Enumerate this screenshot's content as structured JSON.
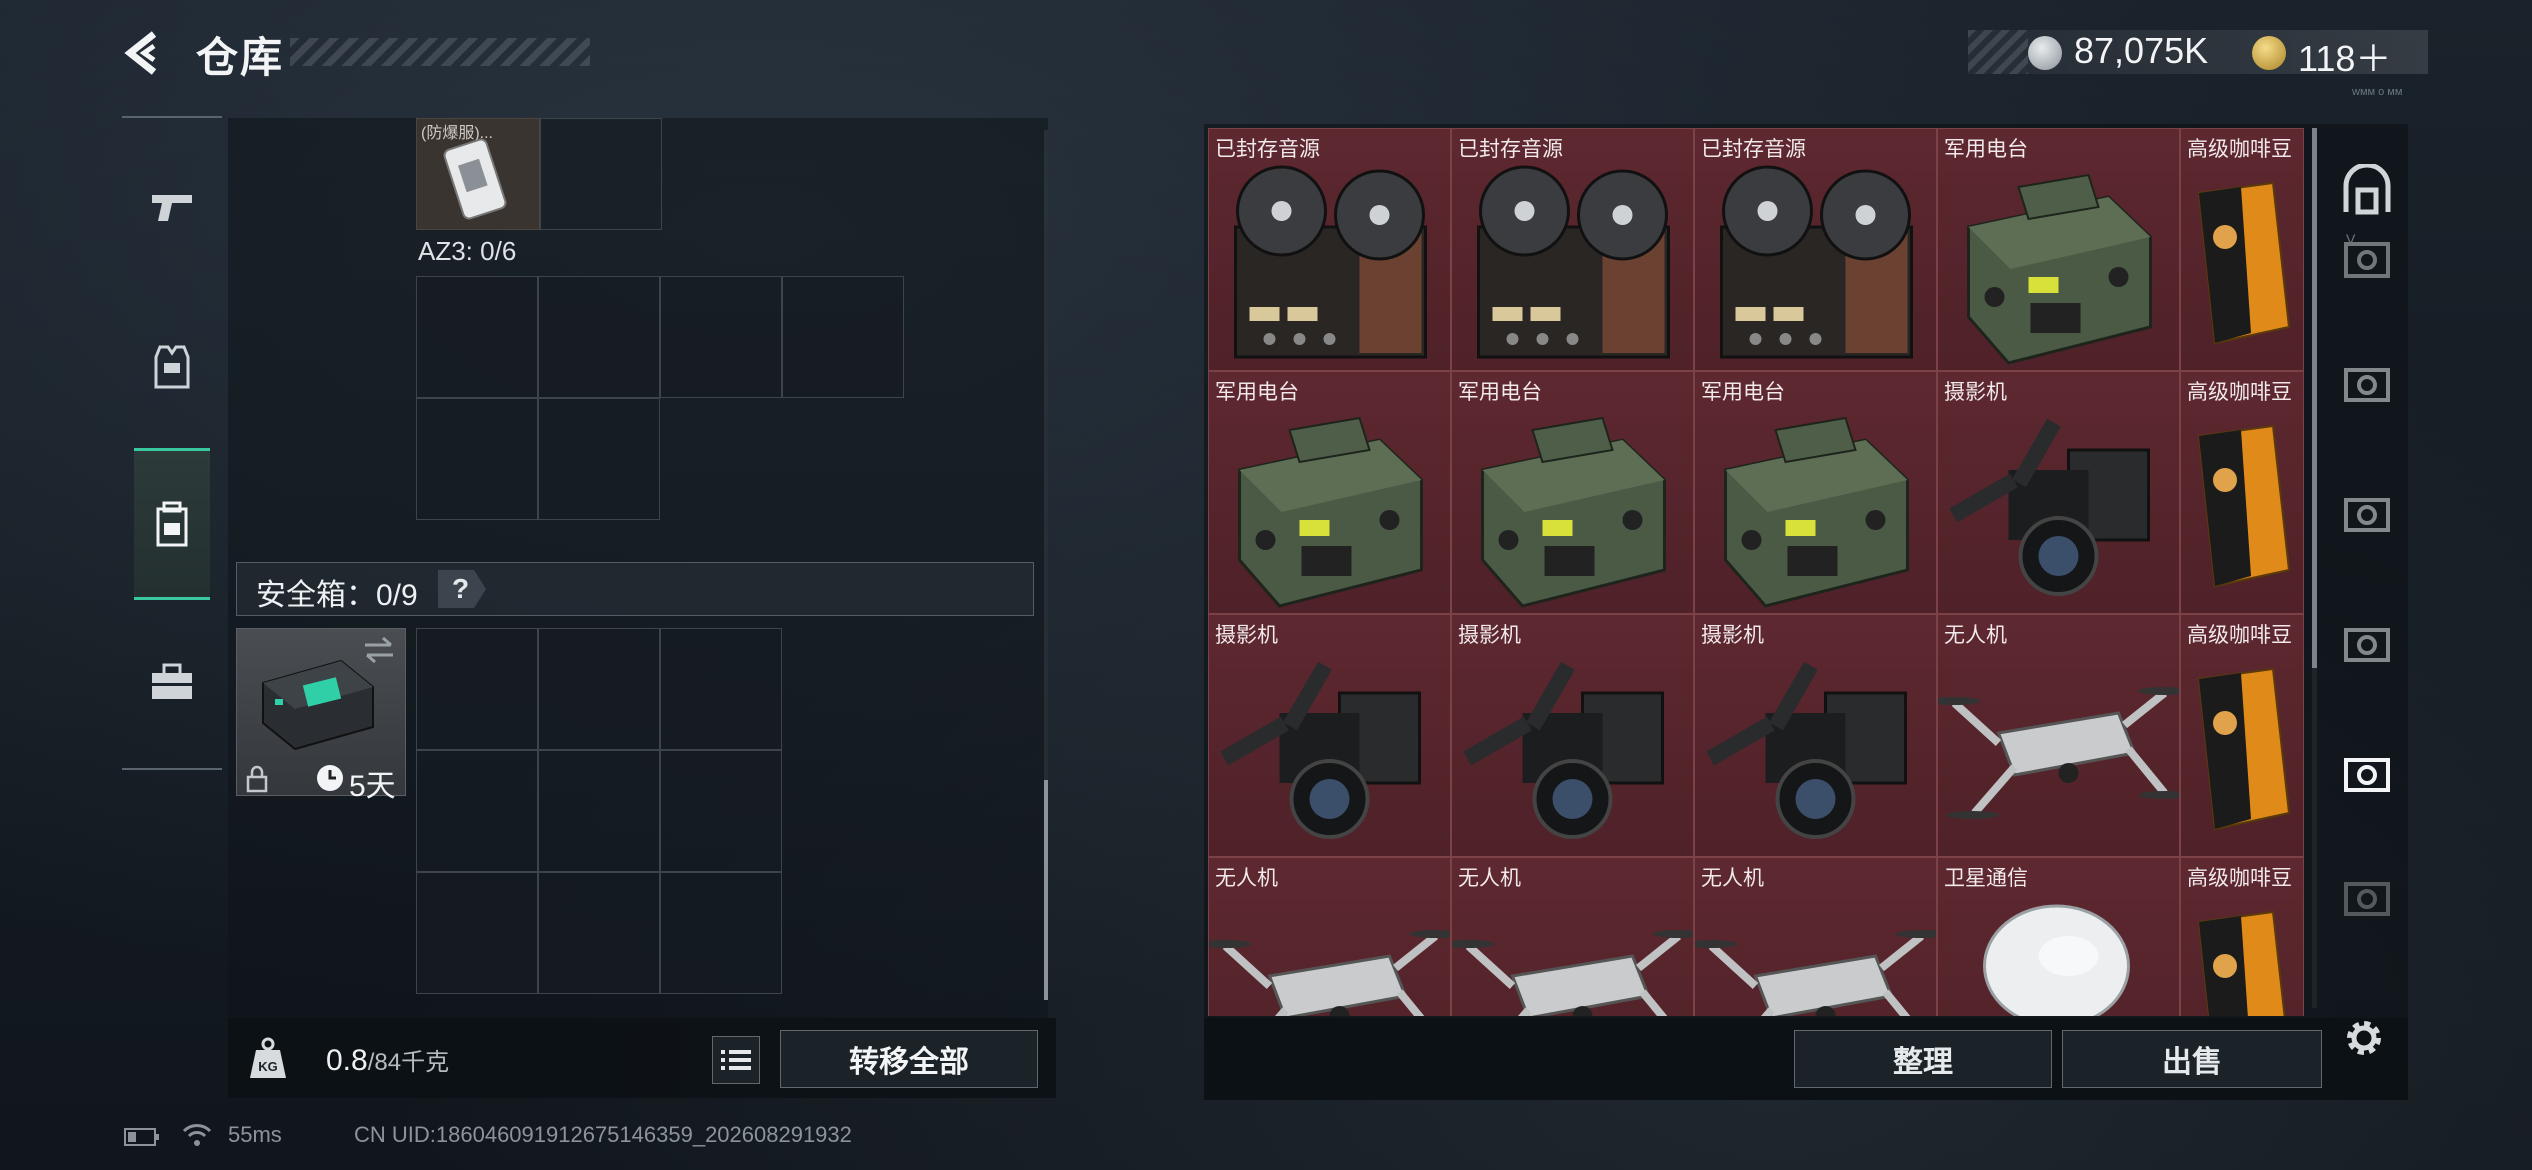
{
  "header": {
    "title": "仓库",
    "currency_silver": "87,075K",
    "currency_gold": "118＋",
    "tiny_code": "ᴡᴍᴍ ᴏ ᴍᴍ"
  },
  "left_tabs": [
    {
      "name": "weapon-tab",
      "icon": "pistol-icon",
      "selected": false
    },
    {
      "name": "armor-tab",
      "icon": "armor-vest-icon",
      "selected": false
    },
    {
      "name": "backpack-tab",
      "icon": "backpack-icon",
      "selected": true
    },
    {
      "name": "toolbox-tab",
      "icon": "briefcase-icon",
      "selected": false
    }
  ],
  "container": {
    "az3_label": "AZ3: 0/6",
    "truncated_item_label": "(防爆服)..."
  },
  "safe_box": {
    "label": "安全箱：0/9",
    "help": "?",
    "duration": "5天"
  },
  "footer_left": {
    "weight_value": "0.8",
    "weight_total": "/84千克",
    "kg_icon_text": "KG",
    "transfer_all": "转移全部"
  },
  "items": [
    {
      "name": "已封存音源",
      "kind": "reel"
    },
    {
      "name": "已封存音源",
      "kind": "reel"
    },
    {
      "name": "已封存音源",
      "kind": "reel"
    },
    {
      "name": "军用电台",
      "kind": "radio"
    },
    {
      "name": "高级咖啡豆",
      "kind": "coffee"
    },
    {
      "name": "军用电台",
      "kind": "radio"
    },
    {
      "name": "军用电台",
      "kind": "radio"
    },
    {
      "name": "军用电台",
      "kind": "radio"
    },
    {
      "name": "摄影机",
      "kind": "camera"
    },
    {
      "name": "高级咖啡豆",
      "kind": "coffee"
    },
    {
      "name": "摄影机",
      "kind": "camera"
    },
    {
      "name": "摄影机",
      "kind": "camera"
    },
    {
      "name": "摄影机",
      "kind": "camera"
    },
    {
      "name": "无人机",
      "kind": "drone"
    },
    {
      "name": "高级咖啡豆",
      "kind": "coffee"
    },
    {
      "name": "无人机",
      "kind": "drone"
    },
    {
      "name": "无人机",
      "kind": "drone"
    },
    {
      "name": "无人机",
      "kind": "drone"
    },
    {
      "name": "卫星通信",
      "kind": "dish"
    },
    {
      "name": "高级咖啡豆",
      "kind": "coffee"
    }
  ],
  "right_footer": {
    "sort": "整理",
    "sell": "出售"
  },
  "status": {
    "ping": "55ms",
    "uid": "CN UID:1860460919126751463​59_202608291932"
  },
  "colors": {
    "accent": "#38c9a0",
    "item_bg": "#5e2830"
  }
}
